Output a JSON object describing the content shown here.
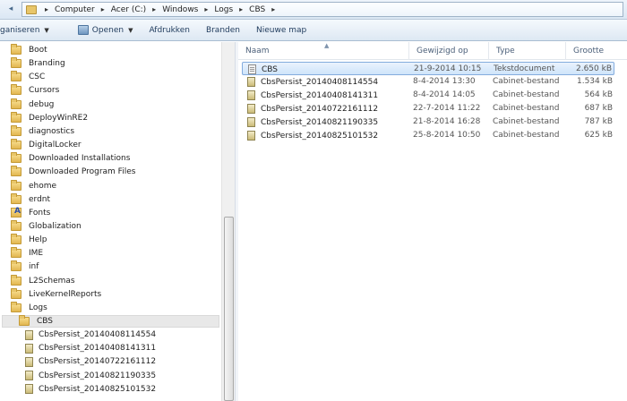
{
  "breadcrumb": [
    "Computer",
    "Acer (C:)",
    "Windows",
    "Logs",
    "CBS"
  ],
  "toolbar": {
    "organize": "ganiseren",
    "open": "Openen",
    "print": "Afdrukken",
    "burn": "Branden",
    "new_folder": "Nieuwe map"
  },
  "columns": {
    "name": "Naam",
    "date": "Gewijzigd op",
    "type": "Type",
    "size": "Grootte"
  },
  "files": [
    {
      "name": "CBS",
      "date": "21-9-2014 10:15",
      "type": "Tekstdocument",
      "size": "2.650 kB",
      "icon": "text-file-icon",
      "selected": true
    },
    {
      "name": "CbsPersist_20140408114554",
      "date": "8-4-2014 13:30",
      "type": "Cabinet-bestand",
      "size": "1.534 kB",
      "icon": "cabinet-file-icon"
    },
    {
      "name": "CbsPersist_20140408141311",
      "date": "8-4-2014 14:05",
      "type": "Cabinet-bestand",
      "size": "564 kB",
      "icon": "cabinet-file-icon"
    },
    {
      "name": "CbsPersist_20140722161112",
      "date": "22-7-2014 11:22",
      "type": "Cabinet-bestand",
      "size": "687 kB",
      "icon": "cabinet-file-icon"
    },
    {
      "name": "CbsPersist_20140821190335",
      "date": "21-8-2014 16:28",
      "type": "Cabinet-bestand",
      "size": "787 kB",
      "icon": "cabinet-file-icon"
    },
    {
      "name": "CbsPersist_20140825101532",
      "date": "25-8-2014 10:50",
      "type": "Cabinet-bestand",
      "size": "625 kB",
      "icon": "cabinet-file-icon"
    }
  ],
  "tree": [
    {
      "label": "Boot",
      "icon": "folder-icon"
    },
    {
      "label": "Branding",
      "icon": "folder-icon"
    },
    {
      "label": "CSC",
      "icon": "folder-icon"
    },
    {
      "label": "Cursors",
      "icon": "folder-icon"
    },
    {
      "label": "debug",
      "icon": "folder-icon"
    },
    {
      "label": "DeployWinRE2",
      "icon": "folder-icon"
    },
    {
      "label": "diagnostics",
      "icon": "folder-icon"
    },
    {
      "label": "DigitalLocker",
      "icon": "folder-icon"
    },
    {
      "label": "Downloaded Installations",
      "icon": "folder-icon"
    },
    {
      "label": "Downloaded Program Files",
      "icon": "folder-icon"
    },
    {
      "label": "ehome",
      "icon": "folder-icon"
    },
    {
      "label": "erdnt",
      "icon": "folder-icon"
    },
    {
      "label": "Fonts",
      "icon": "fonts-folder-icon"
    },
    {
      "label": "Globalization",
      "icon": "folder-icon"
    },
    {
      "label": "Help",
      "icon": "folder-icon"
    },
    {
      "label": "IME",
      "icon": "folder-icon"
    },
    {
      "label": "inf",
      "icon": "folder-icon"
    },
    {
      "label": "L2Schemas",
      "icon": "folder-icon"
    },
    {
      "label": "LiveKernelReports",
      "icon": "folder-icon"
    },
    {
      "label": "Logs",
      "icon": "folder-icon"
    },
    {
      "label": "CBS",
      "icon": "folder-icon",
      "selected": true
    },
    {
      "label": "CbsPersist_20140408114554",
      "icon": "cabinet-file-icon"
    },
    {
      "label": "CbsPersist_20140408141311",
      "icon": "cabinet-file-icon"
    },
    {
      "label": "CbsPersist_20140722161112",
      "icon": "cabinet-file-icon"
    },
    {
      "label": "CbsPersist_20140821190335",
      "icon": "cabinet-file-icon"
    },
    {
      "label": "CbsPersist_20140825101532",
      "icon": "cabinet-file-icon"
    }
  ]
}
